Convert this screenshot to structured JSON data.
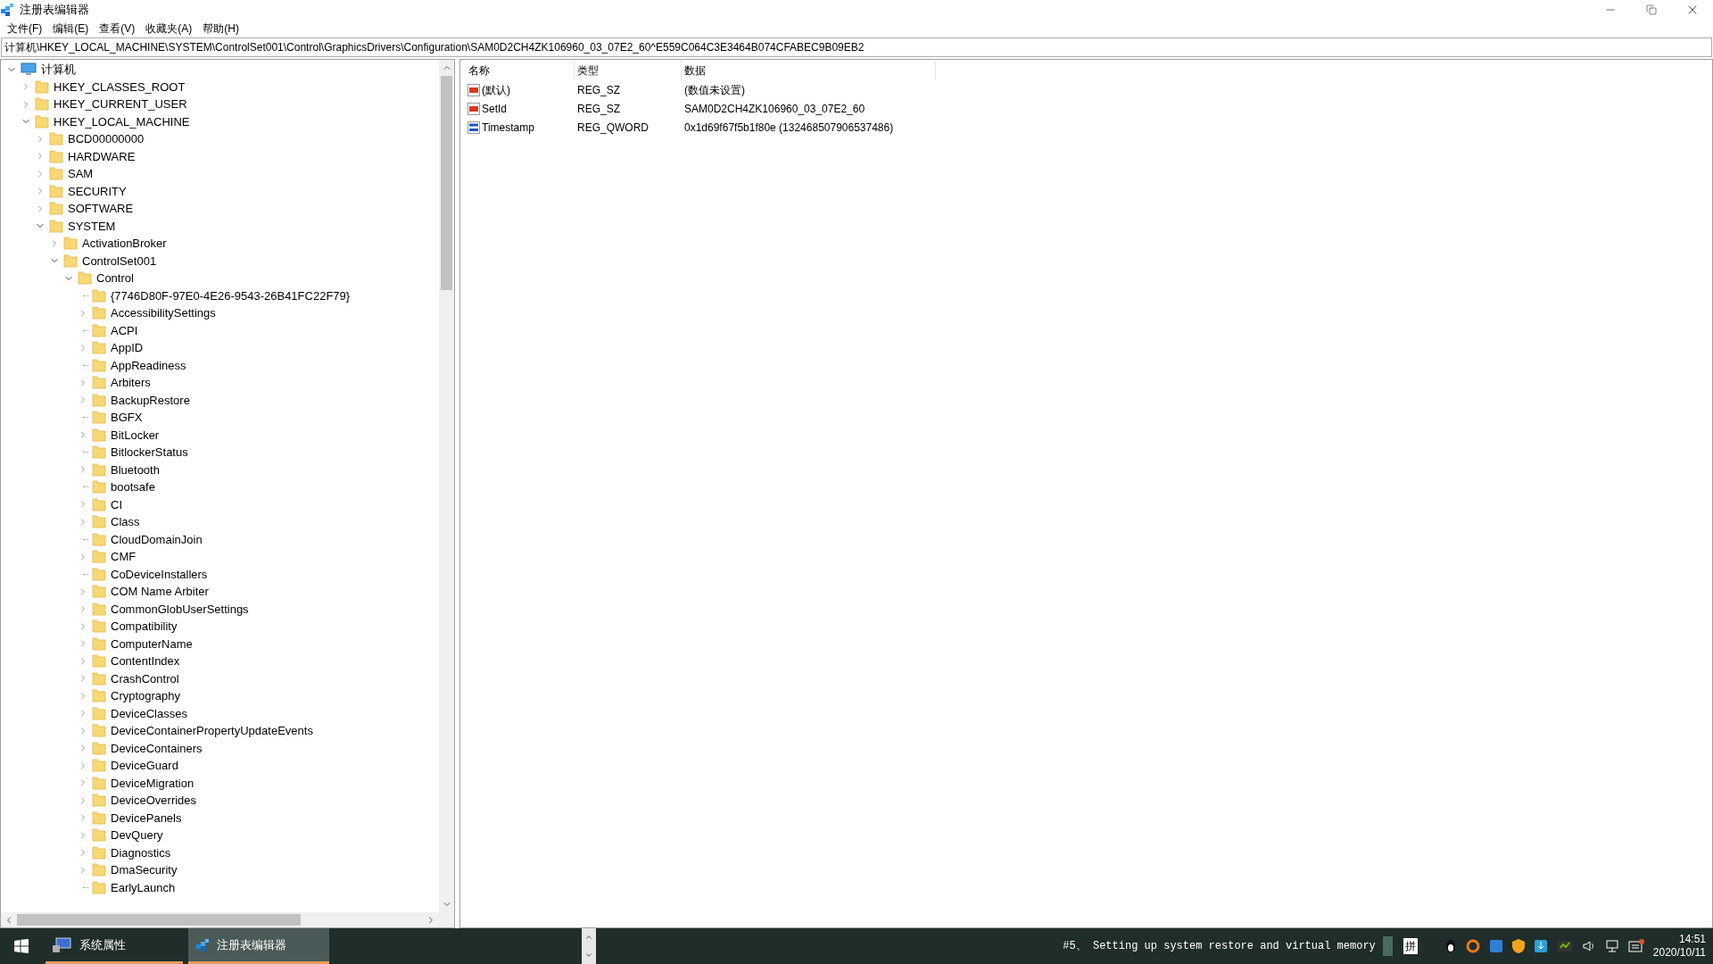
{
  "window": {
    "title": "注册表编辑器"
  },
  "menu": [
    "文件(F)",
    "编辑(E)",
    "查看(V)",
    "收藏夹(A)",
    "帮助(H)"
  ],
  "address": "计算机\\HKEY_LOCAL_MACHINE\\SYSTEM\\ControlSet001\\Control\\GraphicsDrivers\\Configuration\\SAM0D2CH4ZK106960_03_07E2_60^E559C064C3E3464B074CFABEC9B09EB2",
  "tree": [
    {
      "label": "计算机",
      "kind": "computer",
      "has_children": true,
      "expanded": true,
      "children": [
        {
          "label": "HKEY_CLASSES_ROOT",
          "kind": "folder",
          "has_children": true,
          "expanded": false
        },
        {
          "label": "HKEY_CURRENT_USER",
          "kind": "folder",
          "has_children": true,
          "expanded": false
        },
        {
          "label": "HKEY_LOCAL_MACHINE",
          "kind": "folder",
          "has_children": true,
          "expanded": true,
          "children": [
            {
              "label": "BCD00000000",
              "kind": "folder",
              "has_children": true,
              "expanded": false
            },
            {
              "label": "HARDWARE",
              "kind": "folder",
              "has_children": true,
              "expanded": false
            },
            {
              "label": "SAM",
              "kind": "folder",
              "has_children": true,
              "expanded": false
            },
            {
              "label": "SECURITY",
              "kind": "folder",
              "has_children": true,
              "expanded": false
            },
            {
              "label": "SOFTWARE",
              "kind": "folder",
              "has_children": true,
              "expanded": false
            },
            {
              "label": "SYSTEM",
              "kind": "folder",
              "has_children": true,
              "expanded": true,
              "children": [
                {
                  "label": "ActivationBroker",
                  "kind": "folder",
                  "has_children": true,
                  "expanded": false
                },
                {
                  "label": "ControlSet001",
                  "kind": "folder",
                  "has_children": true,
                  "expanded": true,
                  "children": [
                    {
                      "label": "Control",
                      "kind": "folder",
                      "has_children": true,
                      "expanded": true,
                      "children": [
                        {
                          "label": "{7746D80F-97E0-4E26-9543-26B41FC22F79}",
                          "kind": "folder",
                          "has_children": false,
                          "expanded": false
                        },
                        {
                          "label": "AccessibilitySettings",
                          "kind": "folder",
                          "has_children": true,
                          "expanded": false
                        },
                        {
                          "label": "ACPI",
                          "kind": "folder",
                          "has_children": false,
                          "expanded": false
                        },
                        {
                          "label": "AppID",
                          "kind": "folder",
                          "has_children": true,
                          "expanded": false
                        },
                        {
                          "label": "AppReadiness",
                          "kind": "folder",
                          "has_children": false,
                          "expanded": false
                        },
                        {
                          "label": "Arbiters",
                          "kind": "folder",
                          "has_children": true,
                          "expanded": false
                        },
                        {
                          "label": "BackupRestore",
                          "kind": "folder",
                          "has_children": true,
                          "expanded": false
                        },
                        {
                          "label": "BGFX",
                          "kind": "folder",
                          "has_children": false,
                          "expanded": false
                        },
                        {
                          "label": "BitLocker",
                          "kind": "folder",
                          "has_children": true,
                          "expanded": false
                        },
                        {
                          "label": "BitlockerStatus",
                          "kind": "folder",
                          "has_children": false,
                          "expanded": false
                        },
                        {
                          "label": "Bluetooth",
                          "kind": "folder",
                          "has_children": true,
                          "expanded": false
                        },
                        {
                          "label": "bootsafe",
                          "kind": "folder",
                          "has_children": false,
                          "expanded": false
                        },
                        {
                          "label": "CI",
                          "kind": "folder",
                          "has_children": true,
                          "expanded": false
                        },
                        {
                          "label": "Class",
                          "kind": "folder",
                          "has_children": true,
                          "expanded": false
                        },
                        {
                          "label": "CloudDomainJoin",
                          "kind": "folder",
                          "has_children": false,
                          "expanded": false
                        },
                        {
                          "label": "CMF",
                          "kind": "folder",
                          "has_children": true,
                          "expanded": false
                        },
                        {
                          "label": "CoDeviceInstallers",
                          "kind": "folder",
                          "has_children": false,
                          "expanded": false
                        },
                        {
                          "label": "COM Name Arbiter",
                          "kind": "folder",
                          "has_children": true,
                          "expanded": false
                        },
                        {
                          "label": "CommonGlobUserSettings",
                          "kind": "folder",
                          "has_children": true,
                          "expanded": false
                        },
                        {
                          "label": "Compatibility",
                          "kind": "folder",
                          "has_children": true,
                          "expanded": false
                        },
                        {
                          "label": "ComputerName",
                          "kind": "folder",
                          "has_children": true,
                          "expanded": false
                        },
                        {
                          "label": "ContentIndex",
                          "kind": "folder",
                          "has_children": true,
                          "expanded": false
                        },
                        {
                          "label": "CrashControl",
                          "kind": "folder",
                          "has_children": true,
                          "expanded": false
                        },
                        {
                          "label": "Cryptography",
                          "kind": "folder",
                          "has_children": true,
                          "expanded": false
                        },
                        {
                          "label": "DeviceClasses",
                          "kind": "folder",
                          "has_children": true,
                          "expanded": false
                        },
                        {
                          "label": "DeviceContainerPropertyUpdateEvents",
                          "kind": "folder",
                          "has_children": true,
                          "expanded": false
                        },
                        {
                          "label": "DeviceContainers",
                          "kind": "folder",
                          "has_children": true,
                          "expanded": false
                        },
                        {
                          "label": "DeviceGuard",
                          "kind": "folder",
                          "has_children": true,
                          "expanded": false
                        },
                        {
                          "label": "DeviceMigration",
                          "kind": "folder",
                          "has_children": true,
                          "expanded": false
                        },
                        {
                          "label": "DeviceOverrides",
                          "kind": "folder",
                          "has_children": true,
                          "expanded": false
                        },
                        {
                          "label": "DevicePanels",
                          "kind": "folder",
                          "has_children": true,
                          "expanded": false
                        },
                        {
                          "label": "DevQuery",
                          "kind": "folder",
                          "has_children": true,
                          "expanded": false
                        },
                        {
                          "label": "Diagnostics",
                          "kind": "folder",
                          "has_children": true,
                          "expanded": false
                        },
                        {
                          "label": "DmaSecurity",
                          "kind": "folder",
                          "has_children": true,
                          "expanded": false
                        },
                        {
                          "label": "EarlyLaunch",
                          "kind": "folder",
                          "has_children": false,
                          "expanded": false
                        }
                      ]
                    }
                  ]
                }
              ]
            }
          ]
        }
      ]
    }
  ],
  "values": {
    "columns": [
      "名称",
      "类型",
      "数据"
    ],
    "rows": [
      {
        "kind": "string",
        "name": "(默认)",
        "type": "REG_SZ",
        "data": "(数值未设置)"
      },
      {
        "kind": "string",
        "name": "SetId",
        "type": "REG_SZ",
        "data": "SAM0D2CH4ZK106960_03_07E2_60"
      },
      {
        "kind": "binary",
        "name": "Timestamp",
        "type": "REG_QWORD",
        "data": "0x1d69f67f5b1f80e (132468507906537486)"
      }
    ]
  },
  "taskbar": {
    "buttons": [
      {
        "label": "系统属性",
        "kind": "system",
        "selected": false
      },
      {
        "label": "注册表编辑器",
        "kind": "regedit",
        "selected": true
      }
    ],
    "status": "#5、 Setting up system restore and virtual memory",
    "ime": "拼",
    "time": "14:51",
    "date": "2020/10/11"
  }
}
